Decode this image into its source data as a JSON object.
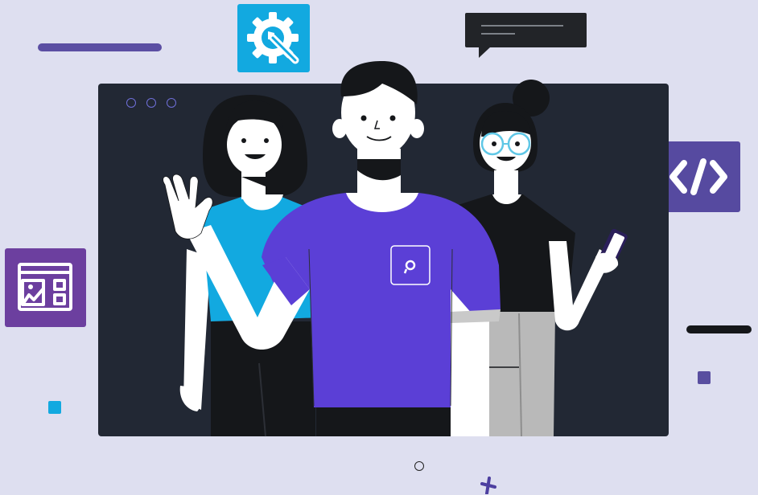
{
  "scene": {
    "colors": {
      "background": "#dedff0",
      "window": "#222834",
      "accent_purple": "#5b3fd6",
      "accent_cyan": "#12a9e0",
      "tile_purple": "#564aa0",
      "tile_violet": "#6c3f9f",
      "dark": "#15171a"
    },
    "icons": {
      "tool": "gear-wrench-icon",
      "chat": "chat-bubble-icon",
      "code": "code-icon",
      "gallery": "image-gallery-icon"
    }
  }
}
